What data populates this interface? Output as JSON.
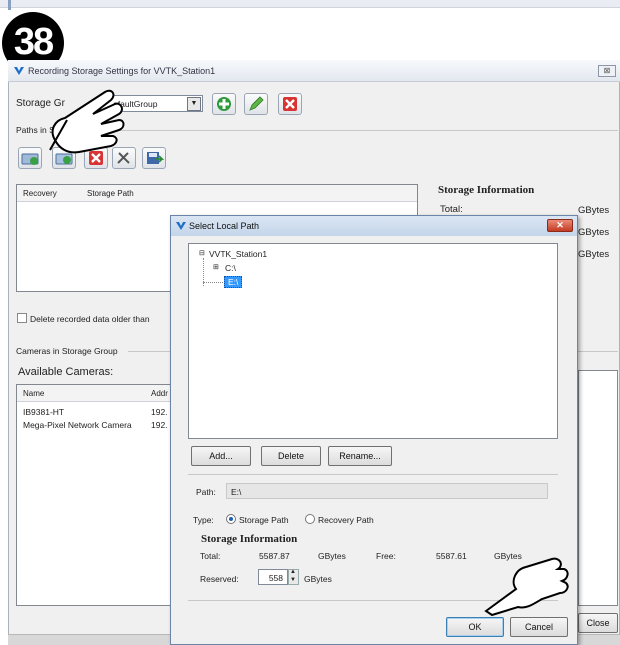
{
  "step_badge": "38",
  "main_window": {
    "title": "Recording Storage Settings for VVTK_Station1",
    "close_label": "⊠",
    "storage_group_label": "Storage Gr",
    "storage_group_value": "efaultGroup",
    "paths_group_label": "Paths in S",
    "paths_group_label_tail": "up",
    "columns": [
      "Recovery",
      "Storage Path"
    ],
    "storage_info": {
      "title": "Storage Information",
      "total_label": "Total:",
      "units": [
        "GBytes",
        "GBytes",
        "GBytes"
      ]
    },
    "delete_checkbox_label": "Delete recorded data older than",
    "cameras_group_label": "Cameras in Storage Group",
    "available_cameras_label": "Available Cameras:",
    "camera_columns": [
      "Name",
      "Addr"
    ],
    "cameras": [
      {
        "name": "IB9381-HT",
        "addr": "192."
      },
      {
        "name": "Mega-Pixel Network Camera",
        "addr": "192."
      }
    ],
    "close_button": "Close"
  },
  "dialog": {
    "title": "Select Local Path",
    "tree": {
      "root": "VVTK_Station1",
      "children": [
        "C:\\",
        "E:\\"
      ],
      "selected": "E:\\"
    },
    "buttons": {
      "add": "Add...",
      "delete": "Delete",
      "rename": "Rename..."
    },
    "path_label": "Path:",
    "path_value": "E:\\",
    "type_label": "Type:",
    "type_options": [
      "Storage Path",
      "Recovery Path"
    ],
    "type_selected": "Storage Path",
    "storage_info": {
      "title": "Storage Information",
      "total_label": "Total:",
      "total_value": "5587.87",
      "total_unit": "GBytes",
      "free_label": "Free:",
      "free_value": "5587.61",
      "free_unit": "GBytes",
      "reserved_label": "Reserved:",
      "reserved_value": "558",
      "reserved_unit": "GBytes"
    },
    "ok": "OK",
    "cancel": "Cancel"
  },
  "colors": {
    "selection": "#3399ff",
    "title_bar": "#c4d5ea",
    "close_red": "#c43b22"
  }
}
